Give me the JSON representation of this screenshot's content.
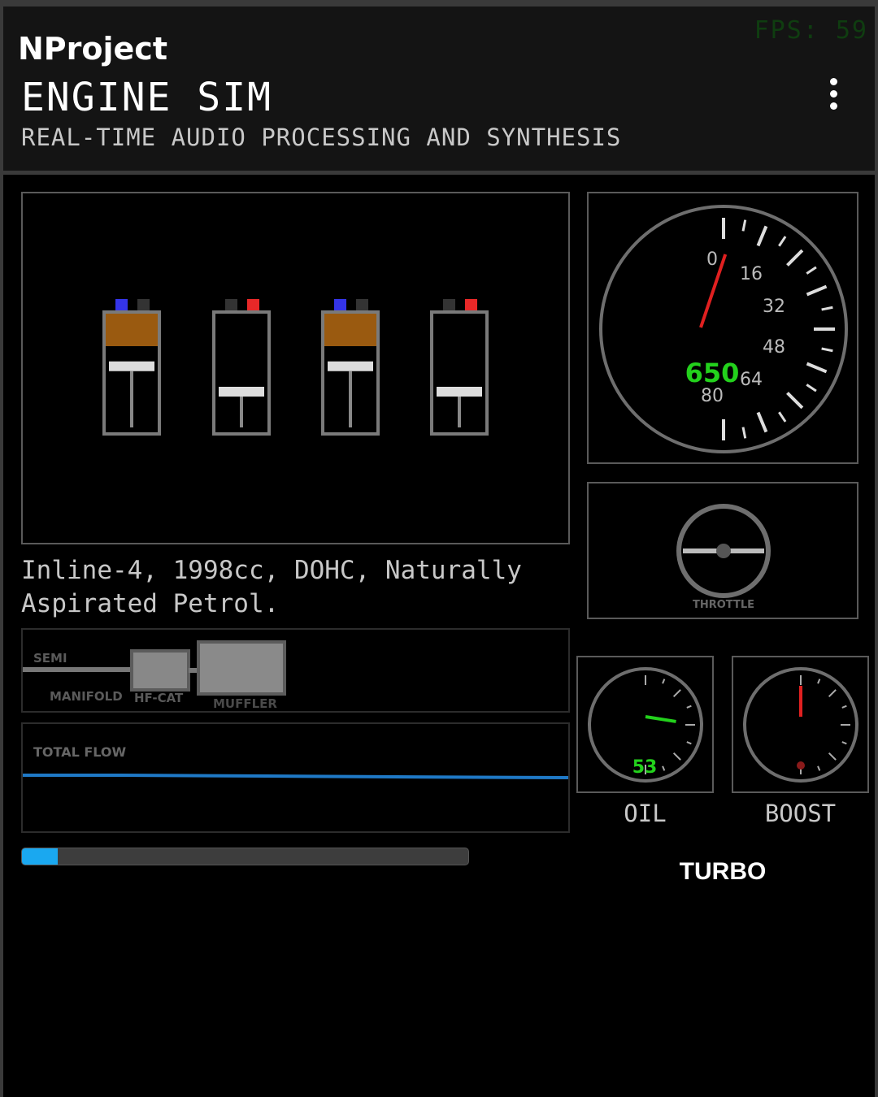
{
  "header": {
    "brand": "NProject",
    "title": "ENGINE SIM",
    "subtitle": "REAL-TIME AUDIO PROCESSING AND SYNTHESIS",
    "fps": "FPS: 59"
  },
  "engine": {
    "description": "Inline-4, 1998cc, DOHC, Naturally Aspirated Petrol.",
    "cylinders": [
      {
        "intake_open": true,
        "exhaust_open": false,
        "combustion": true,
        "piston_level": 0.85
      },
      {
        "intake_open": false,
        "exhaust_open": true,
        "combustion": false,
        "piston_level": 0.6
      },
      {
        "intake_open": true,
        "exhaust_open": false,
        "combustion": true,
        "piston_level": 0.85
      },
      {
        "intake_open": false,
        "exhaust_open": true,
        "combustion": false,
        "piston_level": 0.6
      }
    ]
  },
  "tachometer": {
    "rpm": "650",
    "ticks": [
      "0",
      "16",
      "32",
      "48",
      "64",
      "80"
    ],
    "needle_fraction": 0.04
  },
  "throttle": {
    "label": "THROTTLE",
    "value": 0.0
  },
  "exhaust": {
    "labels": [
      "SEMI",
      "MANIFOLD",
      "HF-CAT",
      "MUFFLER"
    ]
  },
  "flow": {
    "label": "TOTAL FLOW"
  },
  "progress": {
    "value": 0.08
  },
  "oil": {
    "label": "OIL",
    "value": "53",
    "needle_fraction": 0.55
  },
  "boost": {
    "label": "BOOST",
    "needle_fraction": 0.0
  },
  "turbo": {
    "label": "TURBO"
  },
  "colors": {
    "accent_green": "#23d11c",
    "needle_red": "#e02020",
    "intake_blue": "#3434e8",
    "exhaust_red": "#e82828",
    "combustion": "#9a5a10",
    "flow_blue": "#1f79c6",
    "progress_blue": "#1aa8f0"
  }
}
